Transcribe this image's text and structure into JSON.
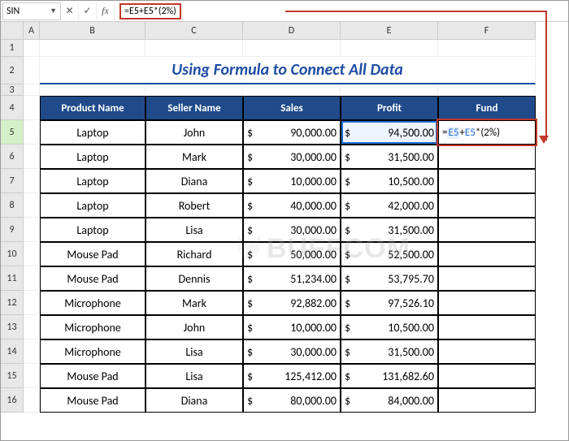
{
  "namebox": {
    "value": "SIN"
  },
  "formula_bar": {
    "value": "=E5+E5*(2%)"
  },
  "title": "Using Formula to Connect All Data",
  "columns": [
    "A",
    "B",
    "C",
    "D",
    "E",
    "F"
  ],
  "row_numbers": [
    "1",
    "2",
    "3",
    "4",
    "5",
    "6",
    "7",
    "8",
    "9",
    "10",
    "11",
    "12",
    "13",
    "14",
    "15",
    "16"
  ],
  "headers": {
    "product": "Product Name",
    "seller": "Seller Name",
    "sales": "Sales",
    "profit": "Profit",
    "fund": "Fund"
  },
  "currency_symbol": "$",
  "editing_cell_text": "=E5+E5*(2%)",
  "rows": [
    {
      "product": "Laptop",
      "seller": "John",
      "sales": "90,000.00",
      "profit": "94,500.00"
    },
    {
      "product": "Laptop",
      "seller": "Mark",
      "sales": "30,000.00",
      "profit": "31,500.00"
    },
    {
      "product": "Laptop",
      "seller": "Diana",
      "sales": "10,000.00",
      "profit": "10,500.00"
    },
    {
      "product": "Laptop",
      "seller": "Robert",
      "sales": "40,000.00",
      "profit": "42,000.00"
    },
    {
      "product": "Laptop",
      "seller": "Lisa",
      "sales": "30,000.00",
      "profit": "31,500.00"
    },
    {
      "product": "Mouse Pad",
      "seller": "Richard",
      "sales": "50,000.00",
      "profit": "52,500.00"
    },
    {
      "product": "Mouse Pad",
      "seller": "Dennis",
      "sales": "51,234.00",
      "profit": "53,795.70"
    },
    {
      "product": "Microphone",
      "seller": "Mark",
      "sales": "92,882.00",
      "profit": "97,526.10"
    },
    {
      "product": "Microphone",
      "seller": "John",
      "sales": "10,000.00",
      "profit": "10,500.00"
    },
    {
      "product": "Microphone",
      "seller": "Lisa",
      "sales": "30,000.00",
      "profit": "31,500.00"
    },
    {
      "product": "Mouse Pad",
      "seller": "Lisa",
      "sales": "125,412.00",
      "profit": "131,682.60"
    },
    {
      "product": "Mouse Pad",
      "seller": "Diana",
      "sales": "80,000.00",
      "profit": "84,000.00"
    }
  ],
  "watermark": "BUFFCOM"
}
